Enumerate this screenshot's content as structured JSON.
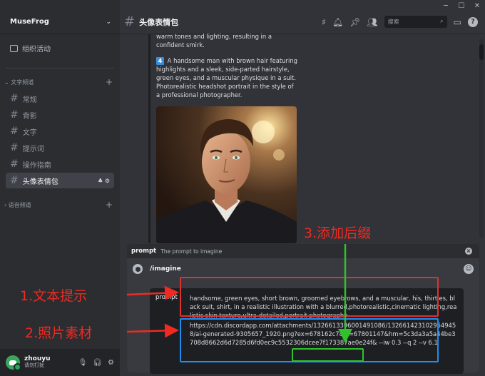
{
  "window": {
    "minimize": "─",
    "maximize": "☐",
    "close": "✕"
  },
  "server": {
    "name": "MuseFrog",
    "chevron": "⌄"
  },
  "events_label": "组织活动",
  "text_category": "文字频道",
  "voice_category": "语音频道",
  "channels": [
    {
      "name": "常规"
    },
    {
      "name": "背影"
    },
    {
      "name": "文字"
    },
    {
      "name": "提示词"
    },
    {
      "name": "操作指南"
    },
    {
      "name": "头像表情包",
      "active": true
    }
  ],
  "user": {
    "name": "zhouyu",
    "status": "请勿打扰"
  },
  "topbar": {
    "channel": "头像表情包",
    "search_placeholder": "搜索"
  },
  "message": {
    "line0": "warm tones and lighting, resulting in a confident smirk.",
    "item_number": "4",
    "item_text": "A handsome man with brown hair featuring highlights and a sleek, side-parted hairstyle, green eyes, and a muscular physique in a suit. Photorealistic headshot portrait in the style of a professional photographer."
  },
  "command_panel": {
    "option_name": "prompt",
    "option_desc": "The prompt to imagine",
    "command": "/imagine",
    "field_label": "prompt",
    "text_prompt": "handsome, green eyes, short brown, groomed eyebrows, and a muscular, his, thirties, black suit, shirt, in a realistic illustration with a blurred,photorealistic,cinematic lighting,realistic skin texture,ultra-detailed,portrait photography",
    "image_url": "https://cdn.discordapp.com/attachments/1326613396001491086/1326614231029649458/ai-generated-9305657_1920.png?ex=678162c7&is=67801147&hm=5c3da3a5a44be3708d8662d6d7285d6fd0ec9c5532306dcee7f173387ae0e24f&",
    "suffix": " --iw 0.3 --q 2 --v 6.1"
  },
  "annotations": {
    "label1": "1.文本提示",
    "label2": "2.照片素材",
    "label3": "3.添加后缀"
  },
  "colors": {
    "red": "#e0312c",
    "blue": "#1f8ef1",
    "green": "#2fc22b",
    "annotation_text": "#ef2a22"
  }
}
